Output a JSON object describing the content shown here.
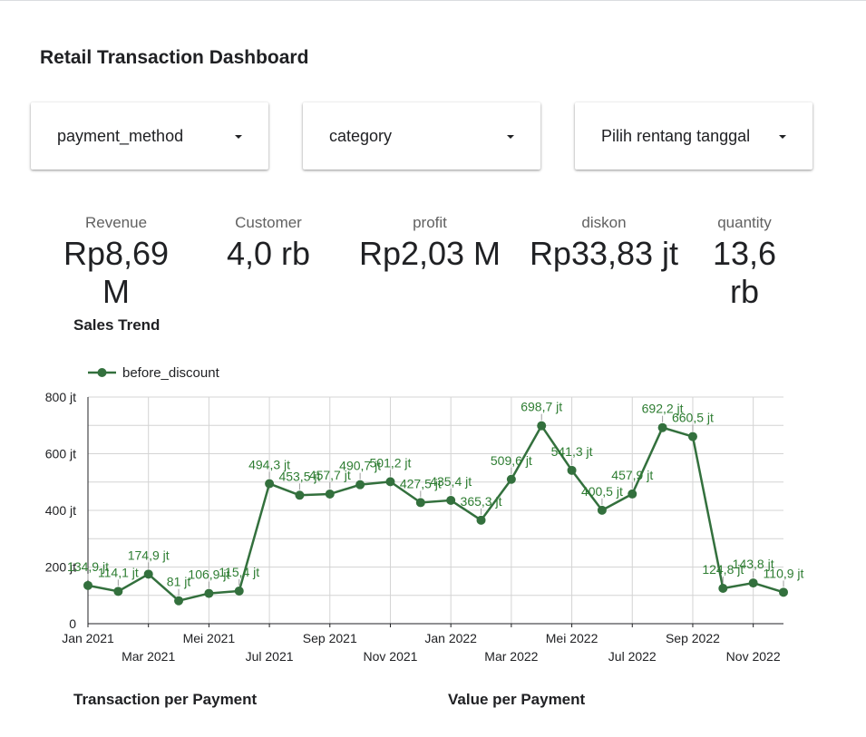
{
  "dashboard": {
    "title": "Retail Transaction Dashboard"
  },
  "filters": [
    {
      "label": "payment_method"
    },
    {
      "label": "category"
    },
    {
      "label": "Pilih rentang tanggal"
    }
  ],
  "kpis": [
    {
      "label": "Revenue",
      "value": "Rp8,69 M"
    },
    {
      "label": "Customer",
      "value": "4,0 rb"
    },
    {
      "label": "profit",
      "value": "Rp2,03 M"
    },
    {
      "label": "diskon",
      "value": "Rp33,83 jt"
    },
    {
      "label": "quantity",
      "value": "13,6 rb"
    }
  ],
  "sections": {
    "sales_trend": "Sales Trend",
    "transaction_per_payment": "Transaction per Payment",
    "value_per_payment": "Value per Payment"
  },
  "colors": {
    "series": "#33703d",
    "label": "#2e7d32",
    "grid": "#d4d4d4"
  },
  "chart_data": {
    "type": "line",
    "title": "Sales Trend",
    "xlabel": "",
    "ylabel": "",
    "legend_position": "top-left",
    "grid": true,
    "ylim": [
      0,
      800
    ],
    "y_ticks": [
      {
        "value": 0,
        "label": "0"
      },
      {
        "value": 200,
        "label": "200 jt"
      },
      {
        "value": 400,
        "label": "400 jt"
      },
      {
        "value": 600,
        "label": "600 jt"
      },
      {
        "value": 800,
        "label": "800 jt"
      }
    ],
    "x": [
      "2021-01",
      "2021-02",
      "2021-03",
      "2021-04",
      "2021-05",
      "2021-06",
      "2021-07",
      "2021-08",
      "2021-09",
      "2021-10",
      "2021-11",
      "2021-12",
      "2022-01",
      "2022-02",
      "2022-03",
      "2022-04",
      "2022-05",
      "2022-06",
      "2022-07",
      "2022-08",
      "2022-09",
      "2022-10",
      "2022-11",
      "2022-12"
    ],
    "x_tick_labels": [
      {
        "index": 0,
        "label": "Jan 2021"
      },
      {
        "index": 2,
        "label": "Mar 2021"
      },
      {
        "index": 4,
        "label": "Mei 2021"
      },
      {
        "index": 6,
        "label": "Jul 2021"
      },
      {
        "index": 8,
        "label": "Sep 2021"
      },
      {
        "index": 10,
        "label": "Nov 2021"
      },
      {
        "index": 12,
        "label": "Jan 2022"
      },
      {
        "index": 14,
        "label": "Mar 2022"
      },
      {
        "index": 16,
        "label": "Mei 2022"
      },
      {
        "index": 18,
        "label": "Jul 2022"
      },
      {
        "index": 20,
        "label": "Sep 2022"
      },
      {
        "index": 22,
        "label": "Nov 2022"
      }
    ],
    "series": [
      {
        "name": "before_discount",
        "values": [
          134.9,
          114.1,
          174.9,
          81,
          106.9,
          115.4,
          494.3,
          453.5,
          457.7,
          490.7,
          501.2,
          427.5,
          435.4,
          365.3,
          509.6,
          698.7,
          541.3,
          400.5,
          457.9,
          692.2,
          660.5,
          124.8,
          143.8,
          110.9
        ],
        "labels": [
          "134,9 jt",
          "114,1 jt",
          "174,9 jt",
          "81 jt",
          "106,9 jt",
          "115,4 jt",
          "494,3 jt",
          "453,5 jt",
          "457,7 jt",
          "490,7 jt",
          "501,2 jt",
          "427,5 jt",
          "435,4 jt",
          "365,3 jt",
          "509,6 jt",
          "698,7 jt",
          "541,3 jt",
          "400,5 jt",
          "457,9 jt",
          "692,2 jt",
          "660,5 jt",
          "124,8 jt",
          "143,8 jt",
          "110,9 jt"
        ]
      }
    ]
  }
}
